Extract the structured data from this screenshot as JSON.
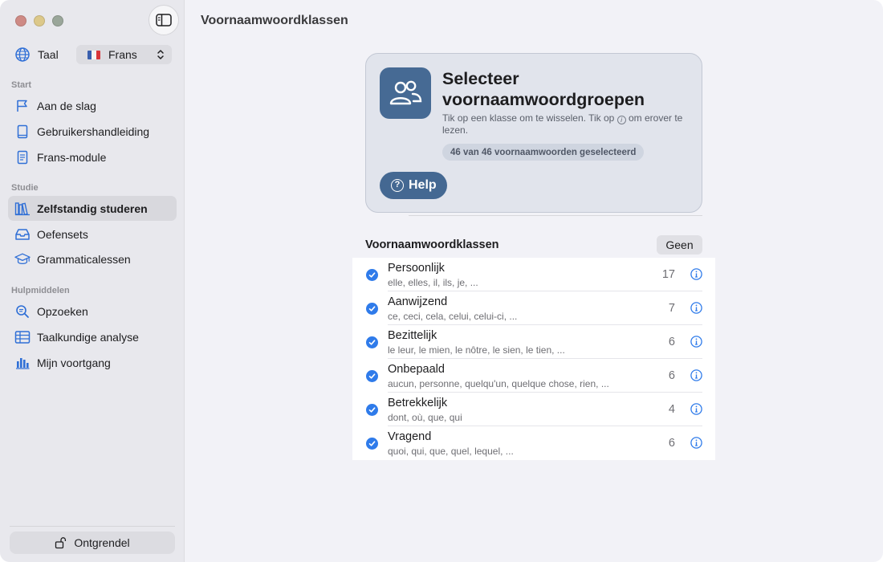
{
  "window": {
    "title": "Voornaamwoordklassen"
  },
  "sidebar": {
    "language": {
      "label": "Taal",
      "selected": "Frans",
      "flag_colors": [
        "#3a5fae",
        "#f4f4f4",
        "#d8363b"
      ]
    },
    "sections": [
      {
        "header": "Start",
        "items": [
          {
            "label": "Aan de slag",
            "icon": "flag-icon"
          },
          {
            "label": "Gebruikershandleiding",
            "icon": "book-icon"
          },
          {
            "label": "Frans-module",
            "icon": "document-icon"
          }
        ]
      },
      {
        "header": "Studie",
        "items": [
          {
            "label": "Zelfstandig studeren",
            "icon": "books-icon",
            "active": true
          },
          {
            "label": "Oefensets",
            "icon": "tray-icon"
          },
          {
            "label": "Grammaticalessen",
            "icon": "graduation-cap-icon"
          }
        ]
      },
      {
        "header": "Hulpmiddelen",
        "items": [
          {
            "label": "Opzoeken",
            "icon": "search-icon"
          },
          {
            "label": "Taalkundige analyse",
            "icon": "table-icon"
          },
          {
            "label": "Mijn voortgang",
            "icon": "bar-chart-icon"
          }
        ]
      }
    ],
    "unlock_label": "Ontgrendel"
  },
  "hero": {
    "title": "Selecteer voornaamwoordgroepen",
    "description_before": "Tik op een klasse om te wisselen. Tik op ",
    "description_info_glyph": "i",
    "description_after": " om erover te lezen.",
    "badge": "46 van 46 voornaamwoorden geselecteerd",
    "help_label": "Help",
    "help_glyph": "?"
  },
  "list": {
    "header": "Voornaamwoordklassen",
    "none_label": "Geen",
    "rows": [
      {
        "name": "Persoonlijk",
        "examples": "elle, elles, il, ils, je, ...",
        "count": "17",
        "checked": true
      },
      {
        "name": "Aanwijzend",
        "examples": "ce, ceci, cela, celui, celui-ci, ...",
        "count": "7",
        "checked": true
      },
      {
        "name": "Bezittelijk",
        "examples": "le leur, le mien, le nôtre, le sien, le tien, ...",
        "count": "6",
        "checked": true
      },
      {
        "name": "Onbepaald",
        "examples": "aucun, personne, quelqu'un, quelque chose, rien, ...",
        "count": "6",
        "checked": true
      },
      {
        "name": "Betrekkelijk",
        "examples": "dont, où, que, qui",
        "count": "4",
        "checked": true
      },
      {
        "name": "Vragend",
        "examples": "quoi, qui, que, quel, lequel, ...",
        "count": "6",
        "checked": true
      }
    ]
  },
  "colors": {
    "accent": "#2f7bea",
    "hero_accent": "#466a94",
    "sidebar_icon": "#2f6fd6"
  }
}
